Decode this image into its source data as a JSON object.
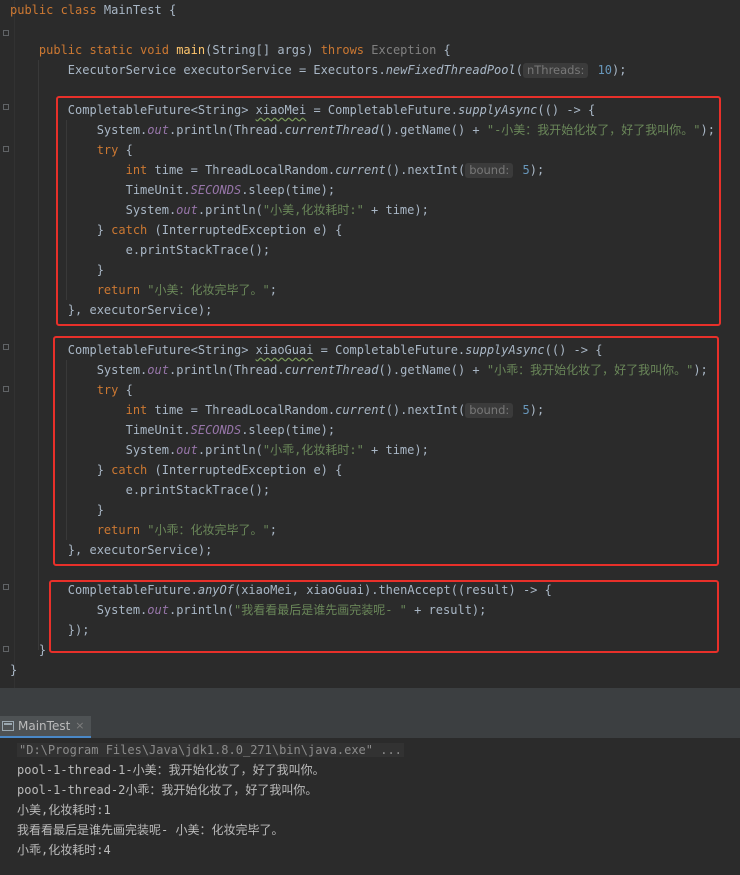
{
  "editor": {
    "lines": [
      {
        "t": [
          [
            "kw",
            "public class "
          ],
          [
            "",
            "MainTest {"
          ]
        ]
      },
      {
        "t": [
          [
            "",
            ""
          ]
        ]
      },
      {
        "t": [
          [
            "",
            "    "
          ],
          [
            "kw",
            "public static void "
          ],
          [
            "fn",
            "main"
          ],
          [
            "",
            "(String[] args) "
          ],
          [
            "kw",
            "throws "
          ],
          [
            "gray",
            "Exception "
          ],
          [
            "",
            "{"
          ]
        ]
      },
      {
        "t": [
          [
            "",
            "        ExecutorService executorService = Executors."
          ],
          [
            "it",
            "newFixedThreadPool"
          ],
          [
            "",
            "("
          ],
          [
            "hint",
            "nThreads:"
          ],
          [
            "num",
            " 10"
          ],
          [
            "",
            ");"
          ]
        ]
      },
      {
        "t": [
          [
            "",
            ""
          ]
        ]
      },
      {
        "t": [
          [
            "",
            "        CompletableFuture<String> "
          ],
          [
            "wavy",
            "xiaoMei"
          ],
          [
            "",
            " = CompletableFuture."
          ],
          [
            "it",
            "supplyAsync"
          ],
          [
            "",
            "(() -> {"
          ]
        ]
      },
      {
        "t": [
          [
            "",
            "            System."
          ],
          [
            "fld",
            "out"
          ],
          [
            "",
            ".println(Thread."
          ],
          [
            "it",
            "currentThread"
          ],
          [
            "",
            "().getName() + "
          ],
          [
            "str",
            "\"-小美：我开始化妆了，好了我叫你。\""
          ],
          [
            "",
            ");"
          ]
        ]
      },
      {
        "t": [
          [
            "",
            "            "
          ],
          [
            "kw",
            "try "
          ],
          [
            "",
            "{"
          ]
        ]
      },
      {
        "t": [
          [
            "",
            "                "
          ],
          [
            "kw",
            "int "
          ],
          [
            "",
            "time = ThreadLocalRandom."
          ],
          [
            "it",
            "current"
          ],
          [
            "",
            "().nextInt("
          ],
          [
            "hint",
            "bound:"
          ],
          [
            "num",
            " 5"
          ],
          [
            "",
            ");"
          ]
        ]
      },
      {
        "t": [
          [
            "",
            "                TimeUnit."
          ],
          [
            "fld",
            "SECONDS"
          ],
          [
            "",
            ".sleep(time);"
          ]
        ]
      },
      {
        "t": [
          [
            "",
            "                System."
          ],
          [
            "fld",
            "out"
          ],
          [
            "",
            ".println("
          ],
          [
            "str",
            "\"小美,化妆耗时:\""
          ],
          [
            "",
            " + time);"
          ]
        ]
      },
      {
        "t": [
          [
            "",
            "            } "
          ],
          [
            "kw",
            "catch "
          ],
          [
            "",
            "(InterruptedException e) {"
          ]
        ]
      },
      {
        "t": [
          [
            "",
            "                e.printStackTrace();"
          ]
        ]
      },
      {
        "t": [
          [
            "",
            "            }"
          ]
        ]
      },
      {
        "t": [
          [
            "",
            "            "
          ],
          [
            "kw",
            "return "
          ],
          [
            "str",
            "\"小美：化妆完毕了。\""
          ],
          [
            "",
            ";"
          ]
        ]
      },
      {
        "t": [
          [
            "",
            "        }, executorService);"
          ]
        ]
      },
      {
        "t": [
          [
            "",
            ""
          ]
        ]
      },
      {
        "t": [
          [
            "",
            "        CompletableFuture<String> "
          ],
          [
            "wavy",
            "xiaoGuai"
          ],
          [
            "",
            " = CompletableFuture."
          ],
          [
            "it",
            "supplyAsync"
          ],
          [
            "",
            "(() -> {"
          ]
        ]
      },
      {
        "t": [
          [
            "",
            "            System."
          ],
          [
            "fld",
            "out"
          ],
          [
            "",
            ".println(Thread."
          ],
          [
            "it",
            "currentThread"
          ],
          [
            "",
            "().getName() + "
          ],
          [
            "str",
            "\"小乖：我开始化妆了，好了我叫你。\""
          ],
          [
            "",
            ");"
          ]
        ]
      },
      {
        "t": [
          [
            "",
            "            "
          ],
          [
            "kw",
            "try "
          ],
          [
            "",
            "{"
          ]
        ]
      },
      {
        "t": [
          [
            "",
            "                "
          ],
          [
            "kw",
            "int "
          ],
          [
            "",
            "time = ThreadLocalRandom."
          ],
          [
            "it",
            "current"
          ],
          [
            "",
            "().nextInt("
          ],
          [
            "hint",
            "bound:"
          ],
          [
            "num",
            " 5"
          ],
          [
            "",
            ");"
          ]
        ]
      },
      {
        "t": [
          [
            "",
            "                TimeUnit."
          ],
          [
            "fld",
            "SECONDS"
          ],
          [
            "",
            ".sleep(time);"
          ]
        ]
      },
      {
        "t": [
          [
            "",
            "                System."
          ],
          [
            "fld",
            "out"
          ],
          [
            "",
            ".println("
          ],
          [
            "str",
            "\"小乖,化妆耗时:\""
          ],
          [
            "",
            " + time);"
          ]
        ]
      },
      {
        "t": [
          [
            "",
            "            } "
          ],
          [
            "kw",
            "catch "
          ],
          [
            "",
            "(InterruptedException e) {"
          ]
        ]
      },
      {
        "t": [
          [
            "",
            "                e.printStackTrace();"
          ]
        ]
      },
      {
        "t": [
          [
            "",
            "            }"
          ]
        ]
      },
      {
        "t": [
          [
            "",
            "            "
          ],
          [
            "kw",
            "return "
          ],
          [
            "str",
            "\"小乖：化妆完毕了。\""
          ],
          [
            "",
            ";"
          ]
        ]
      },
      {
        "t": [
          [
            "",
            "        }, executorService);"
          ]
        ]
      },
      {
        "t": [
          [
            "",
            ""
          ]
        ]
      },
      {
        "t": [
          [
            "",
            "        CompletableFuture."
          ],
          [
            "it",
            "anyOf"
          ],
          [
            "",
            "(xiaoMei, xiaoGuai).thenAccept((result) -> {"
          ]
        ]
      },
      {
        "t": [
          [
            "",
            "            System."
          ],
          [
            "fld",
            "out"
          ],
          [
            "",
            ".println("
          ],
          [
            "str",
            "\"我看看最后是谁先画完装呢- \""
          ],
          [
            "",
            " + result);"
          ]
        ]
      },
      {
        "t": [
          [
            "",
            "        });"
          ]
        ]
      },
      {
        "t": [
          [
            "",
            "    }"
          ]
        ]
      },
      {
        "t": [
          [
            "",
            "}"
          ]
        ]
      }
    ]
  },
  "run_panel": {
    "tab_label": "MainTest",
    "close_glyph": "×"
  },
  "console": {
    "command": "\"D:\\Program Files\\Java\\jdk1.8.0_271\\bin\\java.exe\" ...",
    "lines": [
      "pool-1-thread-1-小美：我开始化妆了，好了我叫你。",
      "pool-1-thread-2小乖：我开始化妆了，好了我叫你。",
      "小美,化妆耗时:1",
      "我看看最后是谁先画完装呢- 小美：化妆完毕了。",
      "小乖,化妆耗时:4"
    ]
  },
  "colors": {
    "keyword": "#cc7832",
    "method": "#ffc66d",
    "string": "#6a8759",
    "number": "#6897bb",
    "field": "#9876aa",
    "highlight_box": "#e8302a"
  }
}
